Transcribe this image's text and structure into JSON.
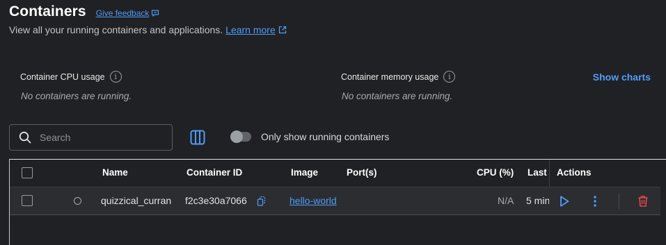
{
  "header": {
    "title": "Containers",
    "feedback_label": "Give feedback",
    "subtitle": "View all your running containers and applications.",
    "learn_more_label": "Learn more"
  },
  "usage": {
    "cpu_label": "Container CPU usage",
    "cpu_empty": "No containers are running.",
    "memory_label": "Container memory usage",
    "memory_empty": "No containers are running.",
    "show_charts_label": "Show charts",
    "info_glyph": "i"
  },
  "toolbar": {
    "search_placeholder": "Search",
    "search_value": "",
    "running_toggle_label": "Only show running containers",
    "running_toggle_on": false
  },
  "table": {
    "columns": {
      "name": "Name",
      "container_id": "Container ID",
      "image": "Image",
      "ports": "Port(s)",
      "cpu": "CPU (%)",
      "last_started": "Last",
      "actions": "Actions"
    },
    "rows": [
      {
        "name": "quizzical_curran",
        "container_id": "f2c3e30a7066",
        "image": "hello-world",
        "ports": "",
        "cpu": "N/A",
        "last_started": "5 min",
        "status": "stopped"
      }
    ]
  },
  "colors": {
    "background": "#202124",
    "accent": "#4f9cf7",
    "delete": "#e5484d"
  },
  "icons": {
    "feedback": "chat-bubble-icon",
    "external": "external-link-icon",
    "info": "info-icon",
    "search": "search-icon",
    "columns": "columns-icon",
    "copy": "copy-icon",
    "play": "play-icon",
    "more": "more-vertical-icon",
    "delete": "trash-icon"
  }
}
